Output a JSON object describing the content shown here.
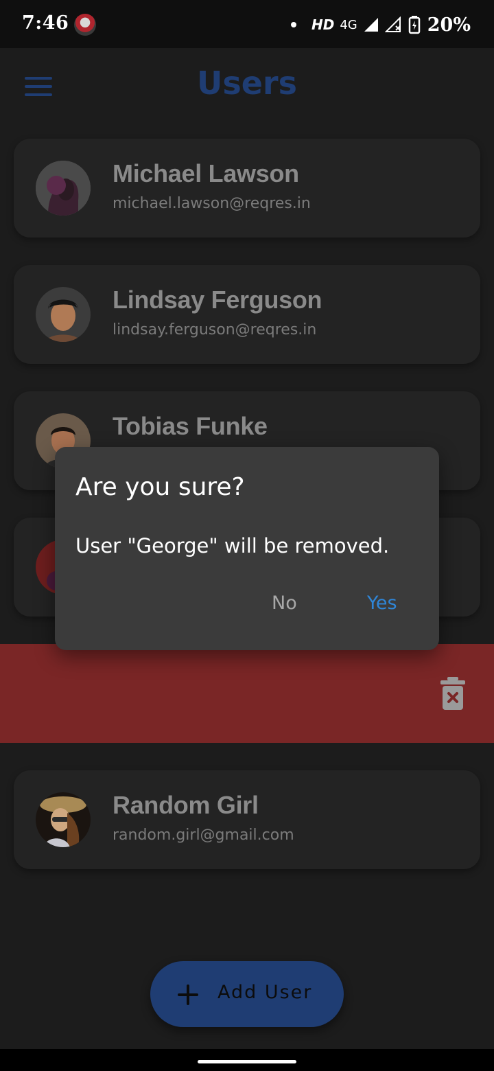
{
  "status_bar": {
    "time": "7:46",
    "hd": "HD",
    "network": "4G",
    "battery": "20%"
  },
  "header": {
    "title": "Users",
    "menu_icon": "hamburger-icon"
  },
  "users": [
    {
      "name": "Michael Lawson",
      "email": "michael.lawson@reqres.in"
    },
    {
      "name": "Lindsay Ferguson",
      "email": "lindsay.ferguson@reqres.in"
    },
    {
      "name": "Tobias Funke",
      "email": ""
    },
    {
      "name": "",
      "email": ""
    },
    {
      "name": "Random Girl",
      "email": "random.girl@gmail.com"
    }
  ],
  "swipe_action": {
    "icon": "trash-icon",
    "color": "#7a2626"
  },
  "dialog": {
    "title": "Are you sure?",
    "message": "User \"George\" will be removed.",
    "no_label": "No",
    "yes_label": "Yes"
  },
  "fab": {
    "label": "Add User",
    "icon": "plus-icon"
  },
  "colors": {
    "primary": "#1f3d73",
    "background": "#1c1c1c",
    "card": "#232323",
    "dialog": "#3b3b3b",
    "accent_yes": "#2f86d8",
    "delete": "#7a2626"
  }
}
